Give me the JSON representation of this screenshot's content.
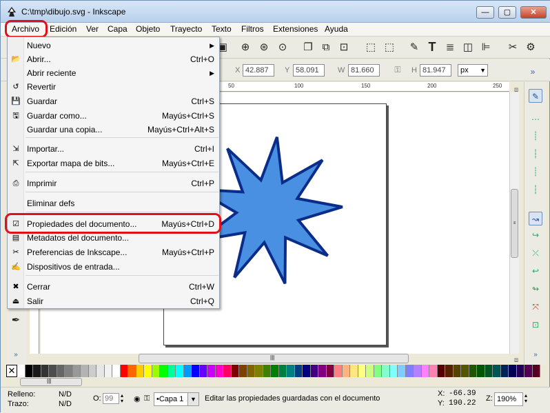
{
  "window": {
    "title": "C:\\tmp\\dibujo.svg - Inkscape",
    "buttons": {
      "minimize": "—",
      "maximize": "▢",
      "close": "✕"
    }
  },
  "menubar": {
    "items": [
      "Archivo",
      "Edición",
      "Ver",
      "Capa",
      "Objeto",
      "Trayecto",
      "Texto",
      "Filtros",
      "Extensiones",
      "Ayuda"
    ]
  },
  "toolbar": {
    "x_label": "X",
    "x_value": "42.887",
    "y_label": "Y",
    "y_value": "58.091",
    "w_label": "W",
    "w_value": "81.660",
    "h_label": "H",
    "h_value": "81.947",
    "unit": "px",
    "more": "»"
  },
  "ruler": {
    "ticks": [
      "50",
      "100",
      "150",
      "200",
      "250"
    ]
  },
  "archivo_menu": {
    "items": [
      {
        "label": "Nuevo",
        "accel": "",
        "icon": "blank-icon",
        "submenu": true
      },
      {
        "label": "Abrir...",
        "accel": "Ctrl+O",
        "icon": "folder-icon",
        "submenu": false
      },
      {
        "label": "Abrir reciente",
        "accel": "",
        "icon": "blank-icon",
        "submenu": true
      },
      {
        "label": "Revertir",
        "accel": "",
        "icon": "revert-icon",
        "submenu": false
      },
      {
        "label": "Guardar",
        "accel": "Ctrl+S",
        "icon": "save-icon",
        "submenu": false
      },
      {
        "label": "Guardar como...",
        "accel": "Mayús+Ctrl+S",
        "icon": "save-as-icon",
        "submenu": false
      },
      {
        "label": "Guardar una copia...",
        "accel": "Mayús+Ctrl+Alt+S",
        "icon": "blank-icon",
        "submenu": false
      },
      {
        "label": "Importar...",
        "accel": "Ctrl+I",
        "icon": "import-icon",
        "submenu": false
      },
      {
        "label": "Exportar mapa de bits...",
        "accel": "Mayús+Ctrl+E",
        "icon": "export-icon",
        "submenu": false
      },
      {
        "label": "Imprimir",
        "accel": "Ctrl+P",
        "icon": "print-icon",
        "submenu": false
      },
      {
        "label": "Eliminar defs",
        "accel": "",
        "icon": "blank-icon",
        "submenu": false
      },
      {
        "label": "Propiedades del documento...",
        "accel": "Mayús+Ctrl+D",
        "icon": "document-properties-icon",
        "submenu": false
      },
      {
        "label": "Metadatos del documento...",
        "accel": "",
        "icon": "metadata-icon",
        "submenu": false
      },
      {
        "label": "Preferencias de Inkscape...",
        "accel": "Mayús+Ctrl+P",
        "icon": "preferences-icon",
        "submenu": false
      },
      {
        "label": "Dispositivos de entrada...",
        "accel": "",
        "icon": "input-devices-icon",
        "submenu": false
      },
      {
        "label": "Cerrar",
        "accel": "Ctrl+W",
        "icon": "close-icon",
        "submenu": false
      },
      {
        "label": "Salir",
        "accel": "Ctrl+Q",
        "icon": "quit-icon",
        "submenu": false
      }
    ]
  },
  "status": {
    "fill_label": "Relleno:",
    "fill_value": "N/D",
    "stroke_label": "Trazo:",
    "stroke_value": "N/D",
    "opacity_label": "O:",
    "opacity_value": "99",
    "layer": "•Capa 1",
    "message": "Editar las propiedades guardadas con el documento",
    "x_label": "X:",
    "x_value": "-66.39",
    "y_label": "Y:",
    "y_value": "190.22",
    "zoom_label": "Z:",
    "zoom_value": "190%"
  },
  "colors": {
    "star_fill": "#4a90e2",
    "star_stroke": "#0a2d8a",
    "highlight": "#e0101a"
  },
  "scroll": {
    "grip": "|||"
  }
}
